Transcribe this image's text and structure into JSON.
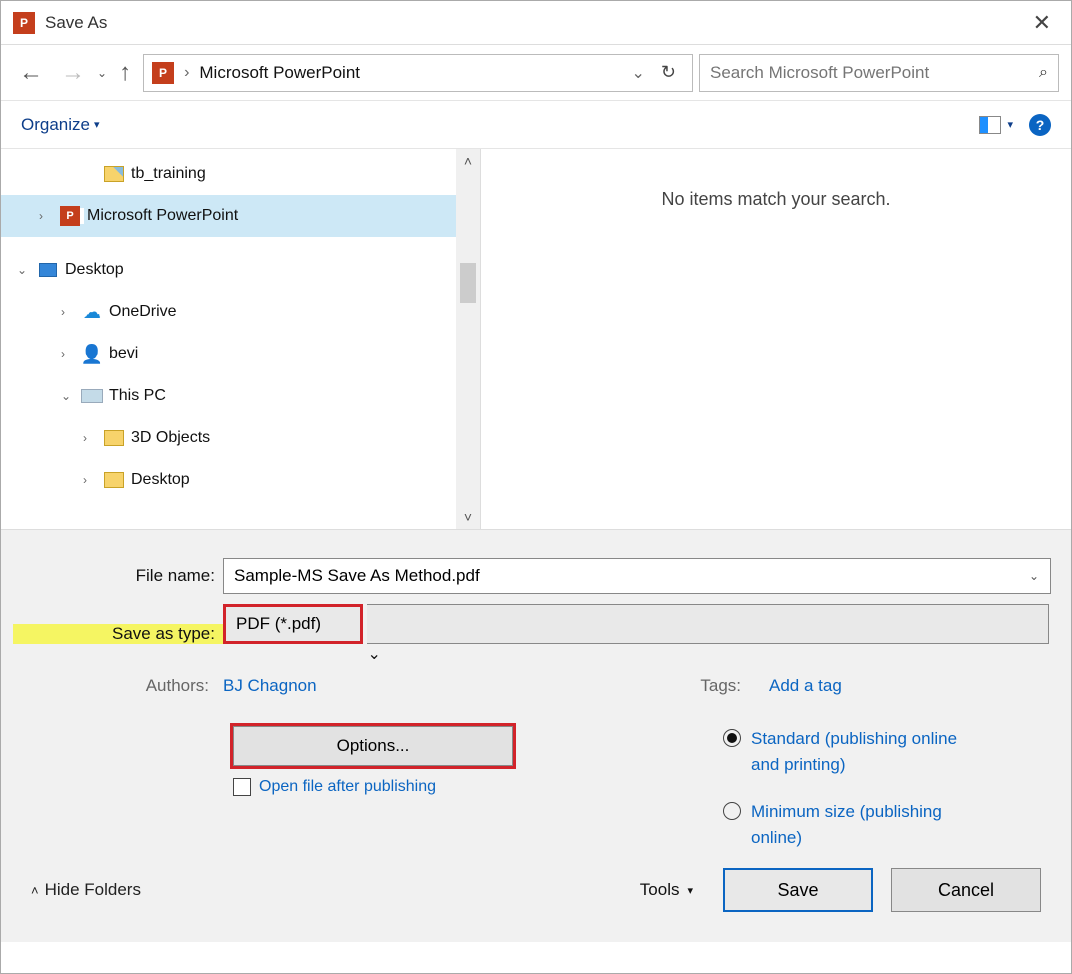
{
  "window": {
    "title": "Save As"
  },
  "nav": {
    "breadcrumb_location": "Microsoft PowerPoint",
    "search_placeholder": "Search Microsoft PowerPoint"
  },
  "toolbar": {
    "organize_label": "Organize"
  },
  "tree": {
    "items": [
      {
        "label": "tb_training",
        "icon": "folder-zip",
        "indent": 3,
        "expand": "",
        "selected": false
      },
      {
        "label": "Microsoft PowerPoint",
        "icon": "ppt",
        "indent": 1,
        "expand": ">",
        "selected": true
      },
      {
        "label": "Desktop",
        "icon": "desktop",
        "indent": 0,
        "expand": "v",
        "selected": false
      },
      {
        "label": "OneDrive",
        "icon": "onedrive",
        "indent": 2,
        "expand": ">",
        "selected": false
      },
      {
        "label": "bevi",
        "icon": "user",
        "indent": 2,
        "expand": ">",
        "selected": false
      },
      {
        "label": "This PC",
        "icon": "pc",
        "indent": 2,
        "expand": "v",
        "selected": false
      },
      {
        "label": "3D Objects",
        "icon": "folder",
        "indent": 3,
        "expand": ">",
        "selected": false
      },
      {
        "label": "Desktop",
        "icon": "folder",
        "indent": 3,
        "expand": ">",
        "selected": false
      }
    ]
  },
  "content": {
    "empty_message": "No items match your search."
  },
  "form": {
    "filename_label": "File name:",
    "filename_value": "Sample-MS Save As Method.pdf",
    "savetype_label": "Save as type:",
    "savetype_value": "PDF (*.pdf)",
    "authors_label": "Authors:",
    "authors_value": "BJ Chagnon",
    "tags_label": "Tags:",
    "tags_value": "Add a tag",
    "options_button": "Options...",
    "openfile_label": "Open file after publishing",
    "optimize": {
      "standard_label": "Standard (publishing online and printing)",
      "minimum_label": "Minimum size (publishing online)",
      "selected": "standard"
    }
  },
  "footer": {
    "hide_folders": "Hide Folders",
    "tools_label": "Tools",
    "save_label": "Save",
    "cancel_label": "Cancel"
  }
}
